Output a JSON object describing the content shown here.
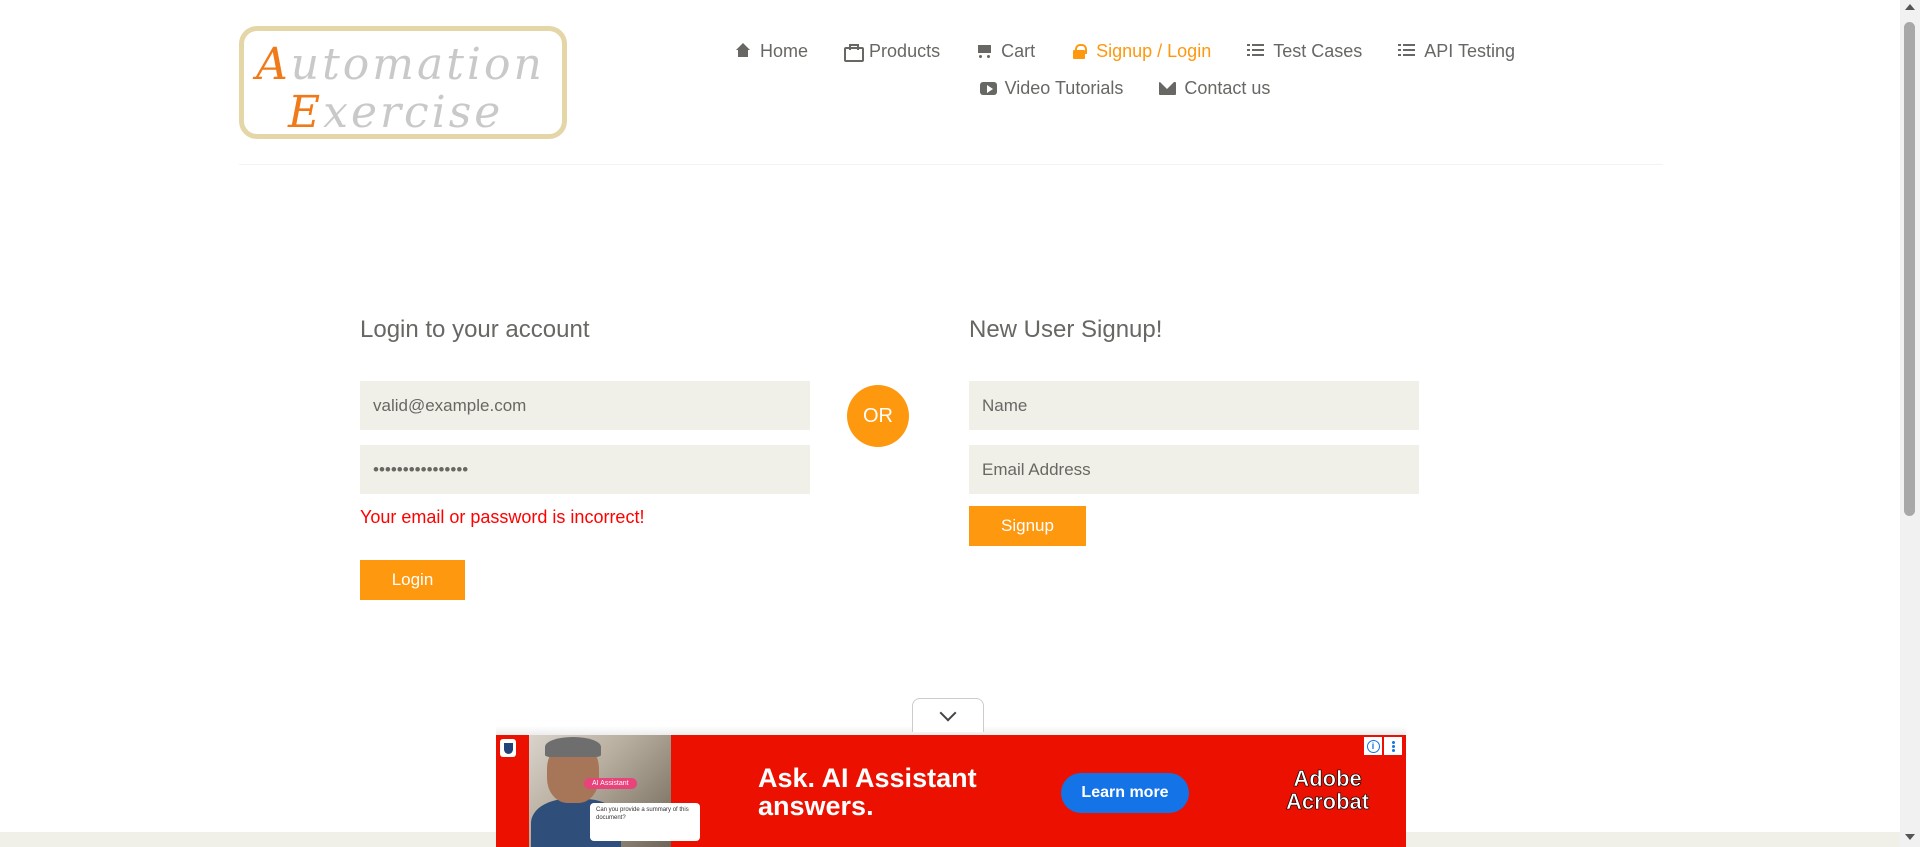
{
  "logo": {
    "line1_cap": "A",
    "line1_rest": "utomation",
    "line2_cap": "E",
    "line2_rest": "xercise"
  },
  "nav": {
    "items": [
      {
        "label": "Home",
        "icon": "home-icon"
      },
      {
        "label": "Products",
        "icon": "briefcase-icon"
      },
      {
        "label": "Cart",
        "icon": "cart-icon"
      },
      {
        "label": "Signup / Login",
        "icon": "lock-icon",
        "active": true
      },
      {
        "label": "Test Cases",
        "icon": "list-icon"
      },
      {
        "label": "API Testing",
        "icon": "list-icon"
      },
      {
        "label": "Video Tutorials",
        "icon": "youtube-icon"
      },
      {
        "label": "Contact us",
        "icon": "envelope-icon"
      }
    ]
  },
  "login": {
    "title": "Login to your account",
    "email_value": "valid@example.com",
    "password_value": "••••••••••••••••",
    "error": "Your email or password is incorrect!",
    "button": "Login"
  },
  "divider": {
    "or_label": "OR"
  },
  "signup": {
    "title": "New User Signup!",
    "name_placeholder": "Name",
    "email_placeholder": "Email Address",
    "button": "Signup"
  },
  "ad": {
    "chip": "AI Assistant",
    "card_text": "Can you provide a summary of this document?",
    "headline_line1": "Ask. AI Assistant",
    "headline_line2": "answers.",
    "cta": "Learn more",
    "brand_line1": "Adobe",
    "brand_line2": "Acrobat",
    "info_glyph": "i"
  },
  "colors": {
    "accent": "#fe980f",
    "error": "#ff0000",
    "field_bg": "#f0f0e9",
    "ad_bg": "#eb1000",
    "ad_cta": "#1473e6"
  }
}
